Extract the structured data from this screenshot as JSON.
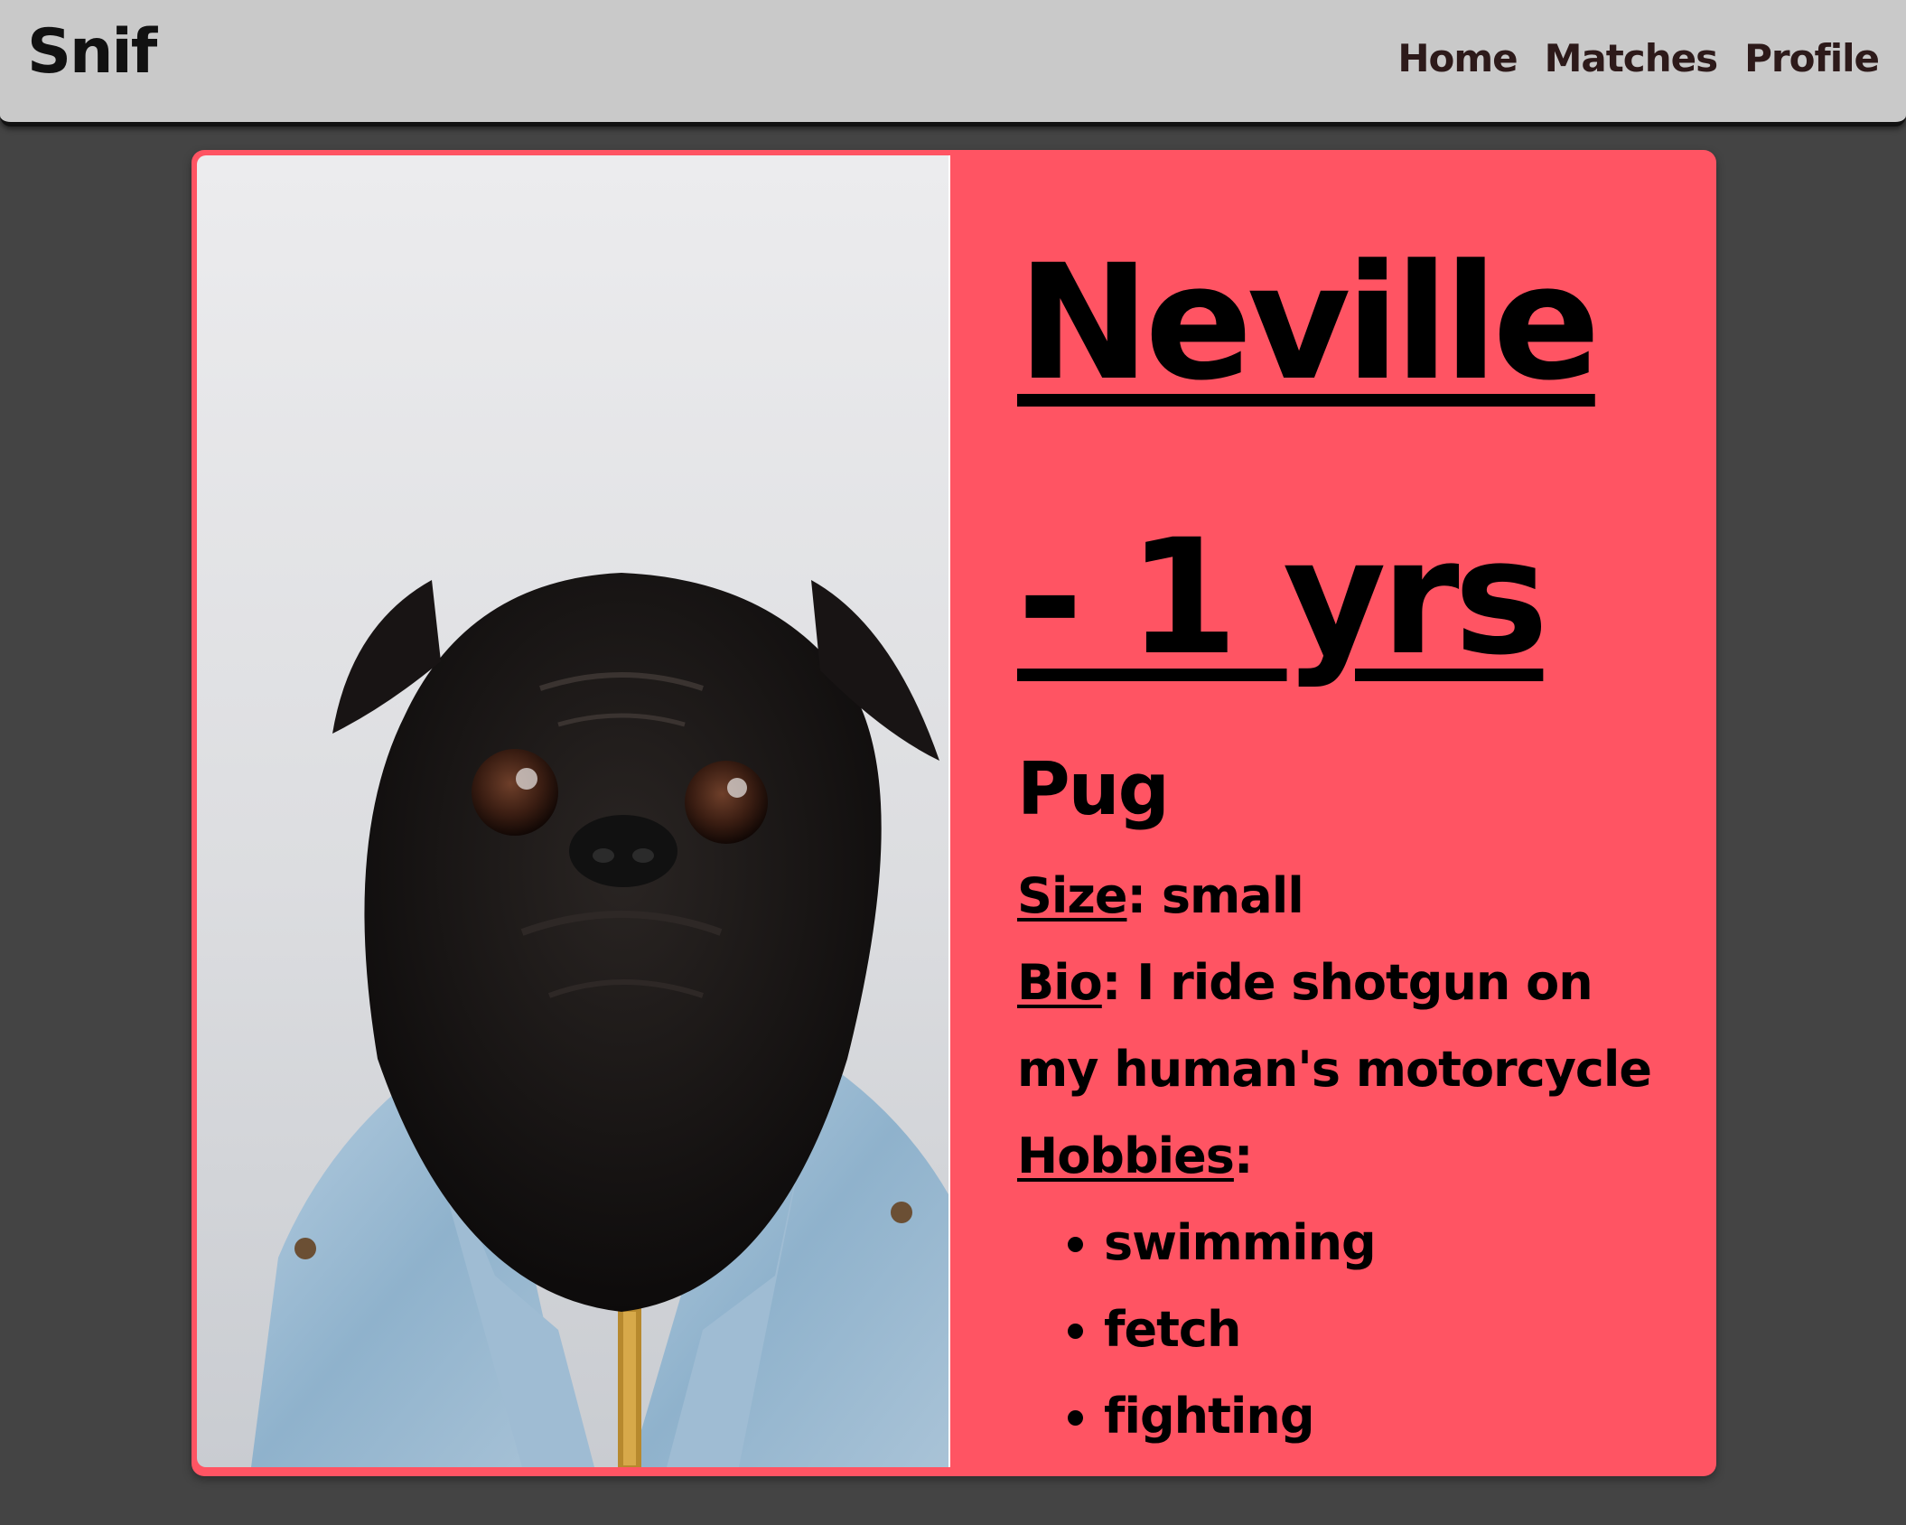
{
  "navbar": {
    "brand": "Snif",
    "links": [
      "Home",
      "Matches",
      "Profile"
    ],
    "background": "#c9c9c9"
  },
  "profile": {
    "name_line1": "Neville",
    "name_line2": "- 1 yrs",
    "breed": "Pug",
    "size_label": "Size",
    "size_value": "small",
    "bio_label": "Bio",
    "bio_value": "I ride shotgun on my human's motorcycle",
    "hobbies_label": "Hobbies",
    "hobbies": [
      "swimming",
      "fetch",
      "fighting"
    ],
    "photo_subject": "black pug wearing denim jacket",
    "card_color": "#ff5463"
  },
  "page": {
    "background": "#444444"
  }
}
